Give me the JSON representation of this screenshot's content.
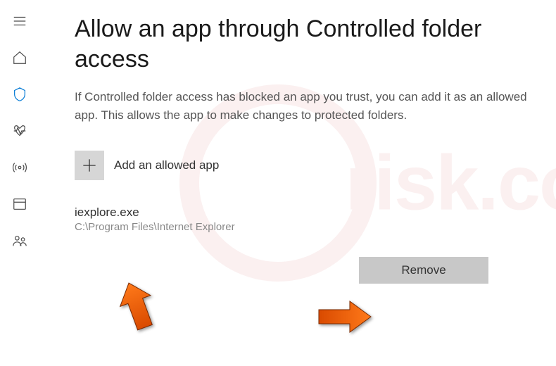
{
  "page": {
    "title": "Allow an app through Controlled folder access",
    "description": "If Controlled folder access has blocked an app you trust, you can add it as an allowed app. This allows the app to make changes to protected folders."
  },
  "add_button": {
    "label": "Add an allowed app"
  },
  "app_list": [
    {
      "name": "iexplore.exe",
      "path": "C:\\Program Files\\Internet Explorer"
    }
  ],
  "remove_button": {
    "label": "Remove"
  },
  "watermark": {
    "text": "risk.com"
  }
}
